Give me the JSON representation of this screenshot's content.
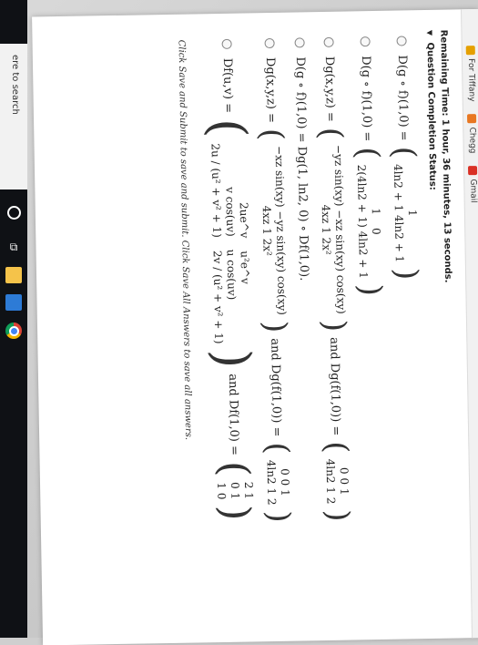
{
  "browser": {
    "bookmarks": [
      {
        "label": "For Tiffany",
        "color": "#e5a000"
      },
      {
        "label": "Chegg",
        "color": "#e87722"
      },
      {
        "label": "Gmail",
        "color": "#d93025"
      }
    ]
  },
  "assessment": {
    "timer": "Remaining Time: 1 hour, 36 minutes, 13 seconds.",
    "status": "Question Completion Status:",
    "note": "Click Save and Submit to save and submit. Click Save All Answers to save all answers."
  },
  "options": [
    {
      "label": "D(g ∘ f)(1,0) =",
      "rows": [
        [
          "0"
        ],
        [
          "1"
        ],
        [
          "4ln2 + 1  4ln2 + 1"
        ]
      ]
    },
    {
      "label": "D(g ∘ f)(1,0) =",
      "rows": [
        [
          "1",
          "0"
        ],
        [
          "2(4ln2 + 1)  4ln2 + 1"
        ]
      ]
    },
    {
      "label": "Dg(x,y,z) =",
      "rows": [
        [
          "−yz sin(xy)  −xz sin(xy)  cos(xy)"
        ],
        [
          "4xz  1  2x²"
        ]
      ],
      "tail": "and Dg(f(1,0)) =",
      "tail_rows": [
        [
          "0  0  1"
        ],
        [
          "4ln2  1  2"
        ]
      ]
    },
    {
      "label": "D(g ∘ f)(1,0) = Dg(1, ln2, 0) ∘ Df(1,0).",
      "rows": []
    },
    {
      "label": "Dg(x,y,z) =",
      "rows": [
        [
          "−xz sin(xy)  −yz sin(xy)  cos(xy)"
        ],
        [
          "4xz  1  2x²"
        ]
      ],
      "tail": "and Dg(f(1,0)) =",
      "tail_rows": [
        [
          "0  0  1"
        ],
        [
          "4ln2  1  2"
        ]
      ]
    },
    {
      "label": "Df(u,v) =",
      "rows": [
        [
          "2ue^v",
          "u²e^v"
        ],
        [
          "v cos(uv)",
          "u cos(uv)"
        ],
        [
          "2u / (u² + v² + 1)",
          "2v / (u² + v² + 1)"
        ]
      ],
      "tail": "and Df(1,0) =",
      "tail_rows": [
        [
          "2  1"
        ],
        [
          "0  1"
        ],
        [
          "1  0"
        ]
      ]
    }
  ],
  "taskbar": {
    "search_placeholder": "ere to search",
    "icons": [
      "cortana-icon",
      "task-view-icon",
      "file-explorer-icon",
      "store-icon",
      "chrome-icon"
    ]
  }
}
